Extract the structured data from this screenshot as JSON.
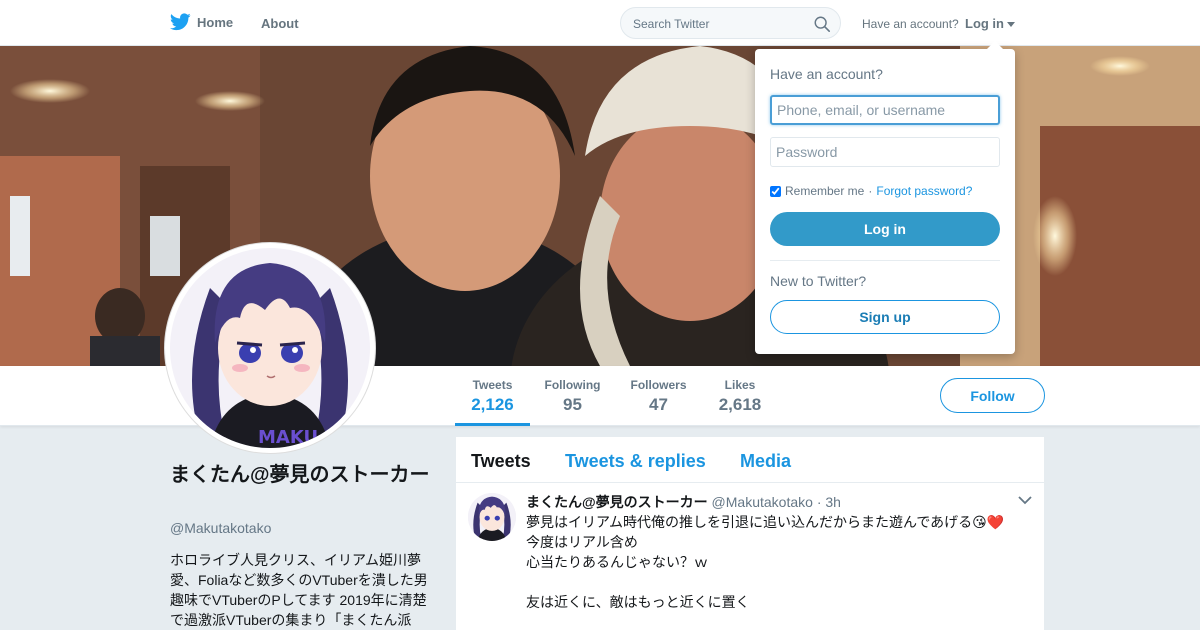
{
  "nav": {
    "home_label": "Home",
    "about_label": "About",
    "search_placeholder": "Search Twitter",
    "have_account": "Have an account?",
    "login_label": "Log in"
  },
  "profile": {
    "name": "まくたん@夢見のストーカー",
    "handle": "@Makutakotako",
    "bio": "ホロライブ人見クリス、イリアム姫川夢愛、Foliaなど数多くのVTuberを潰した男 趣味でVTuberのPしてます 2019年に清楚で過激派VTuberの集まり「まくたん派",
    "stats": [
      {
        "label": "Tweets",
        "value": "2,126"
      },
      {
        "label": "Following",
        "value": "95"
      },
      {
        "label": "Followers",
        "value": "47"
      },
      {
        "label": "Likes",
        "value": "2,618"
      }
    ],
    "follow_label": "Follow"
  },
  "timeline": {
    "tabs": [
      "Tweets",
      "Tweets & replies",
      "Media"
    ],
    "tweet": {
      "name": "まくたん@夢見のストーカー",
      "handle": "@Makutakotako",
      "time": "· 3h",
      "lines": [
        "夢見はイリアム時代俺の推しを引退に追い込んだからまた遊んであげる😘❤️",
        "今度はリアル含め",
        "心当たりあるんじゃない？ｗ",
        "",
        "友は近くに、敵はもっと近くに置く"
      ]
    }
  },
  "login_dropdown": {
    "question": "Have an account?",
    "username_placeholder": "Phone, email, or username",
    "password_placeholder": "Password",
    "remember_label": "Remember me",
    "separator": "·",
    "forgot_label": "Forgot password?",
    "login_button": "Log in",
    "new_label": "New to Twitter?",
    "signup_button": "Sign up"
  },
  "colors": {
    "twitter_blue": "#1b95e0",
    "login_button_bg": "#329ac9",
    "background": "#e6ecf0"
  }
}
